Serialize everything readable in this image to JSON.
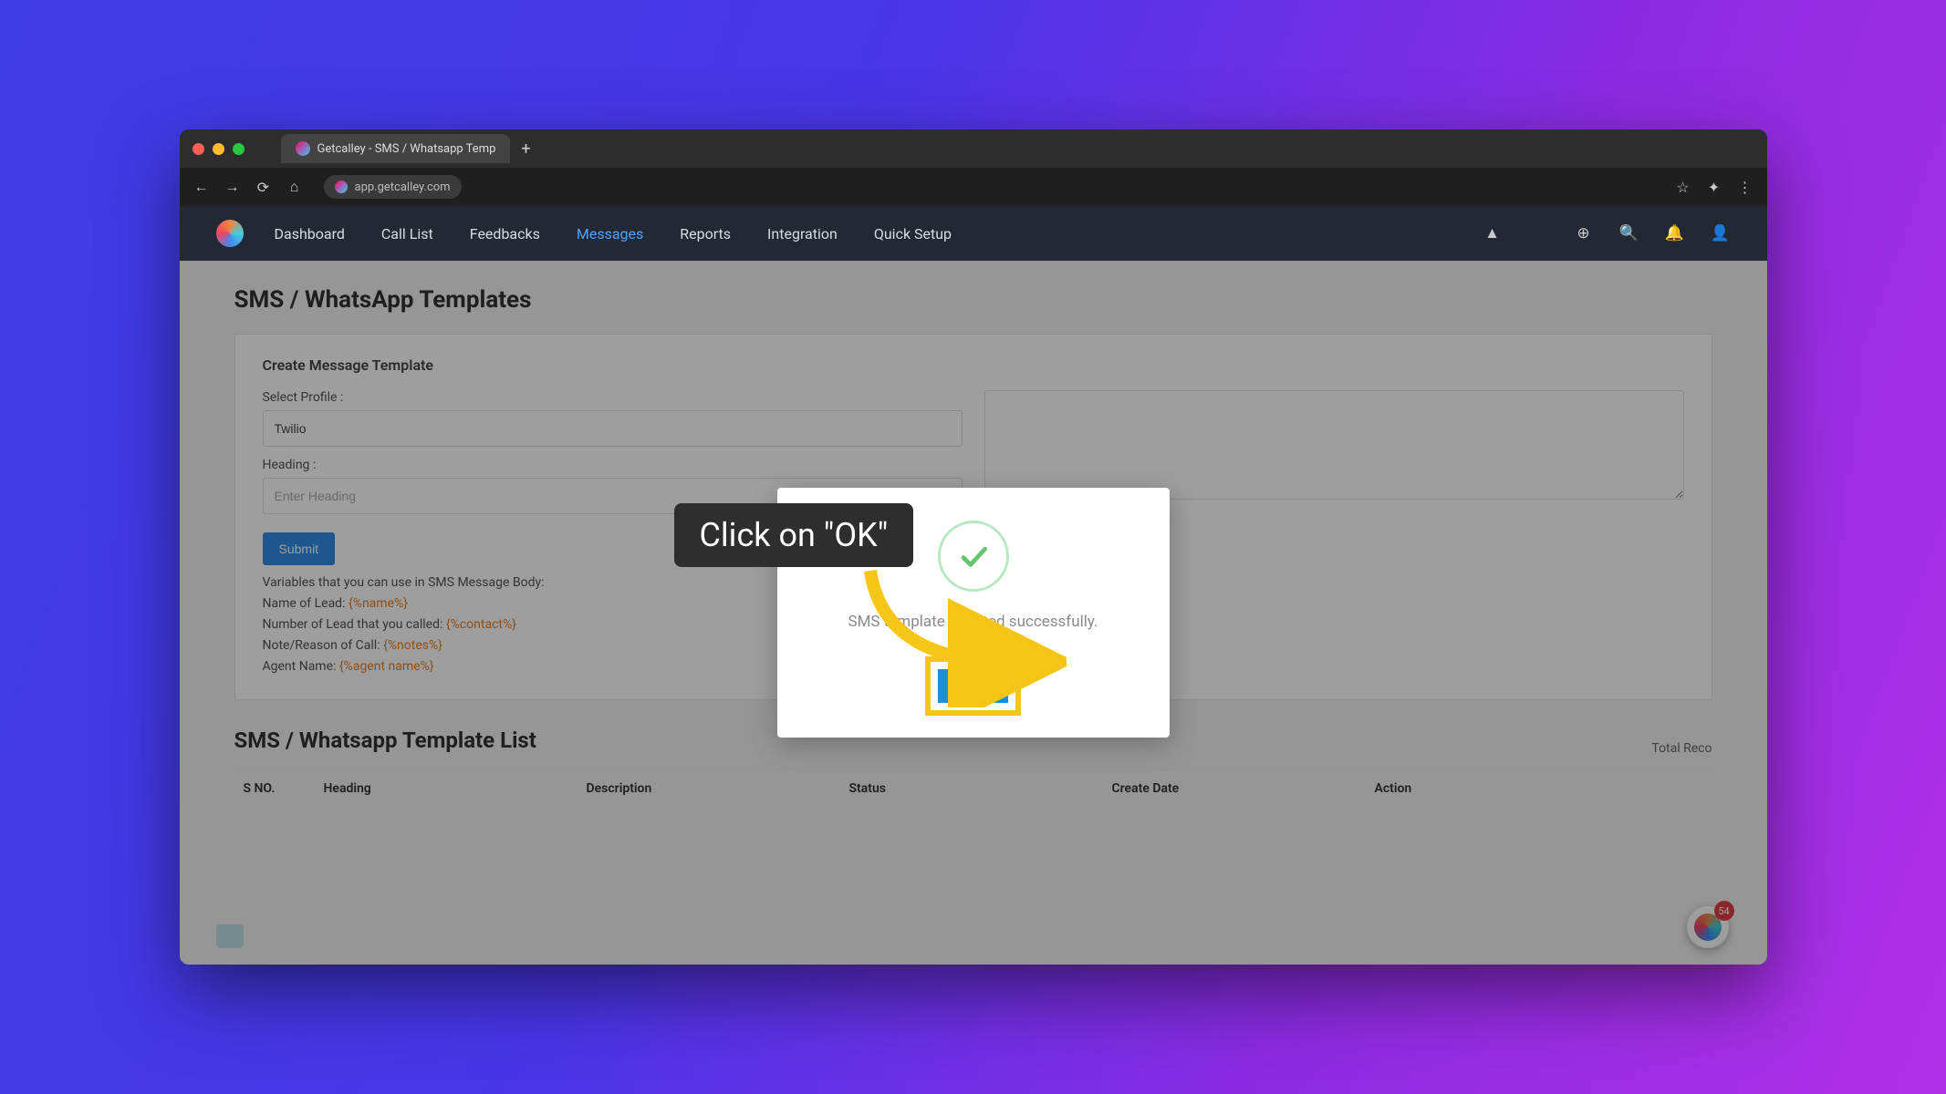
{
  "browser": {
    "tab_title": "Getcalley - SMS / Whatsapp Temp",
    "url": "app.getcalley.com"
  },
  "nav": {
    "items": [
      "Dashboard",
      "Call List",
      "Feedbacks",
      "Messages",
      "Reports",
      "Integration",
      "Quick Setup"
    ],
    "active_index": 3
  },
  "page": {
    "title": "SMS / WhatsApp Templates",
    "card_title": "Create Message Template",
    "select_profile_label": "Select Profile :",
    "select_profile_value": "Twilio",
    "heading_label": "Heading :",
    "heading_placeholder": "Enter Heading",
    "submit": "Submit",
    "vars_intro": "Variables that you can use in SMS Message Body:",
    "vars": [
      {
        "label": "Name of Lead:",
        "token": "{%name%}"
      },
      {
        "label": "Number of Lead that you called:",
        "token": "{%contact%}"
      },
      {
        "label": "Note/Reason of Call:",
        "token": "{%notes%}"
      },
      {
        "label": "Agent Name:",
        "token": "{%agent name%}"
      }
    ],
    "list_title": "SMS / Whatsapp Template List",
    "total_records_label": "Total Reco",
    "table_headers": [
      "S NO.",
      "Heading",
      "Description",
      "Status",
      "Create Date",
      "Action"
    ]
  },
  "modal": {
    "message": "SMS template inserted successfully.",
    "ok": "OK"
  },
  "callout": {
    "text": "Click on \"OK\""
  },
  "badge_count": "54"
}
